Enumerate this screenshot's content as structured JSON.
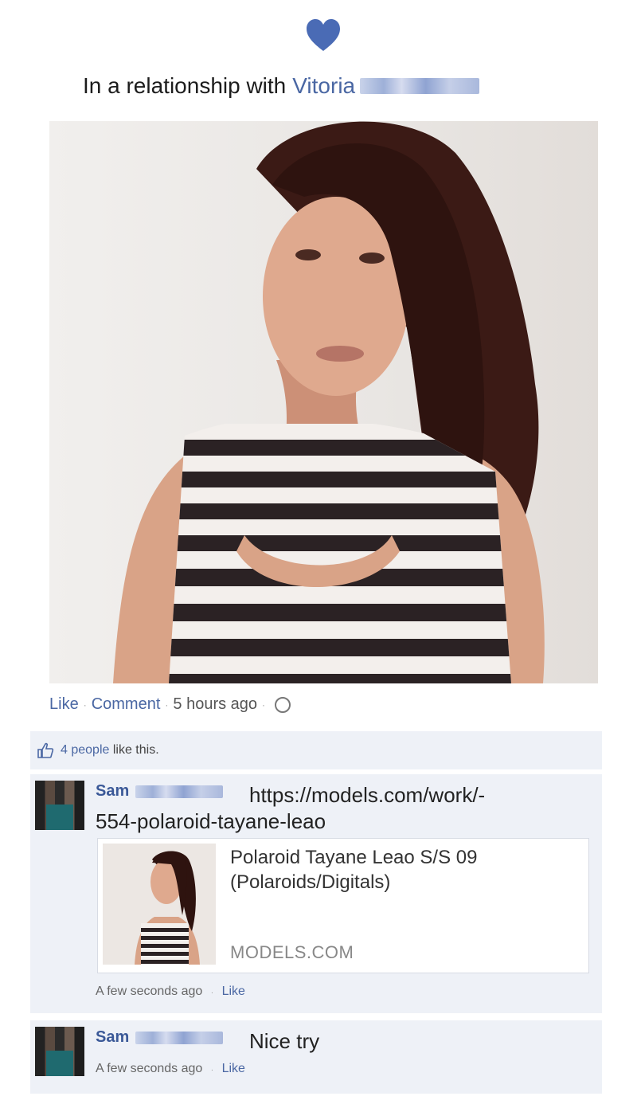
{
  "relationship": {
    "text": "In a relationship with",
    "name": "Vitoria"
  },
  "colors": {
    "heart": "#4a6bb5",
    "link": "#4a67a3",
    "comment_bg": "#eef1f7"
  },
  "post": {
    "like_label": "Like",
    "comment_label": "Comment",
    "timestamp": "5 hours ago",
    "likes_count": "4 people",
    "likes_suffix": "like this."
  },
  "comments": [
    {
      "author": "Sam",
      "text_line1": "https://models.com/work/-",
      "text_line2": "554-polaroid-tayane-leao",
      "link_card": {
        "title_line1": "Polaroid Tayane Leao S/S 09",
        "title_line2": "(Polaroids/Digitals)",
        "domain": "MODELS.COM"
      },
      "time": "A few seconds ago",
      "like_label": "Like"
    },
    {
      "author": "Sam",
      "text": "Nice try",
      "time": "A few seconds ago",
      "like_label": "Like"
    }
  ]
}
